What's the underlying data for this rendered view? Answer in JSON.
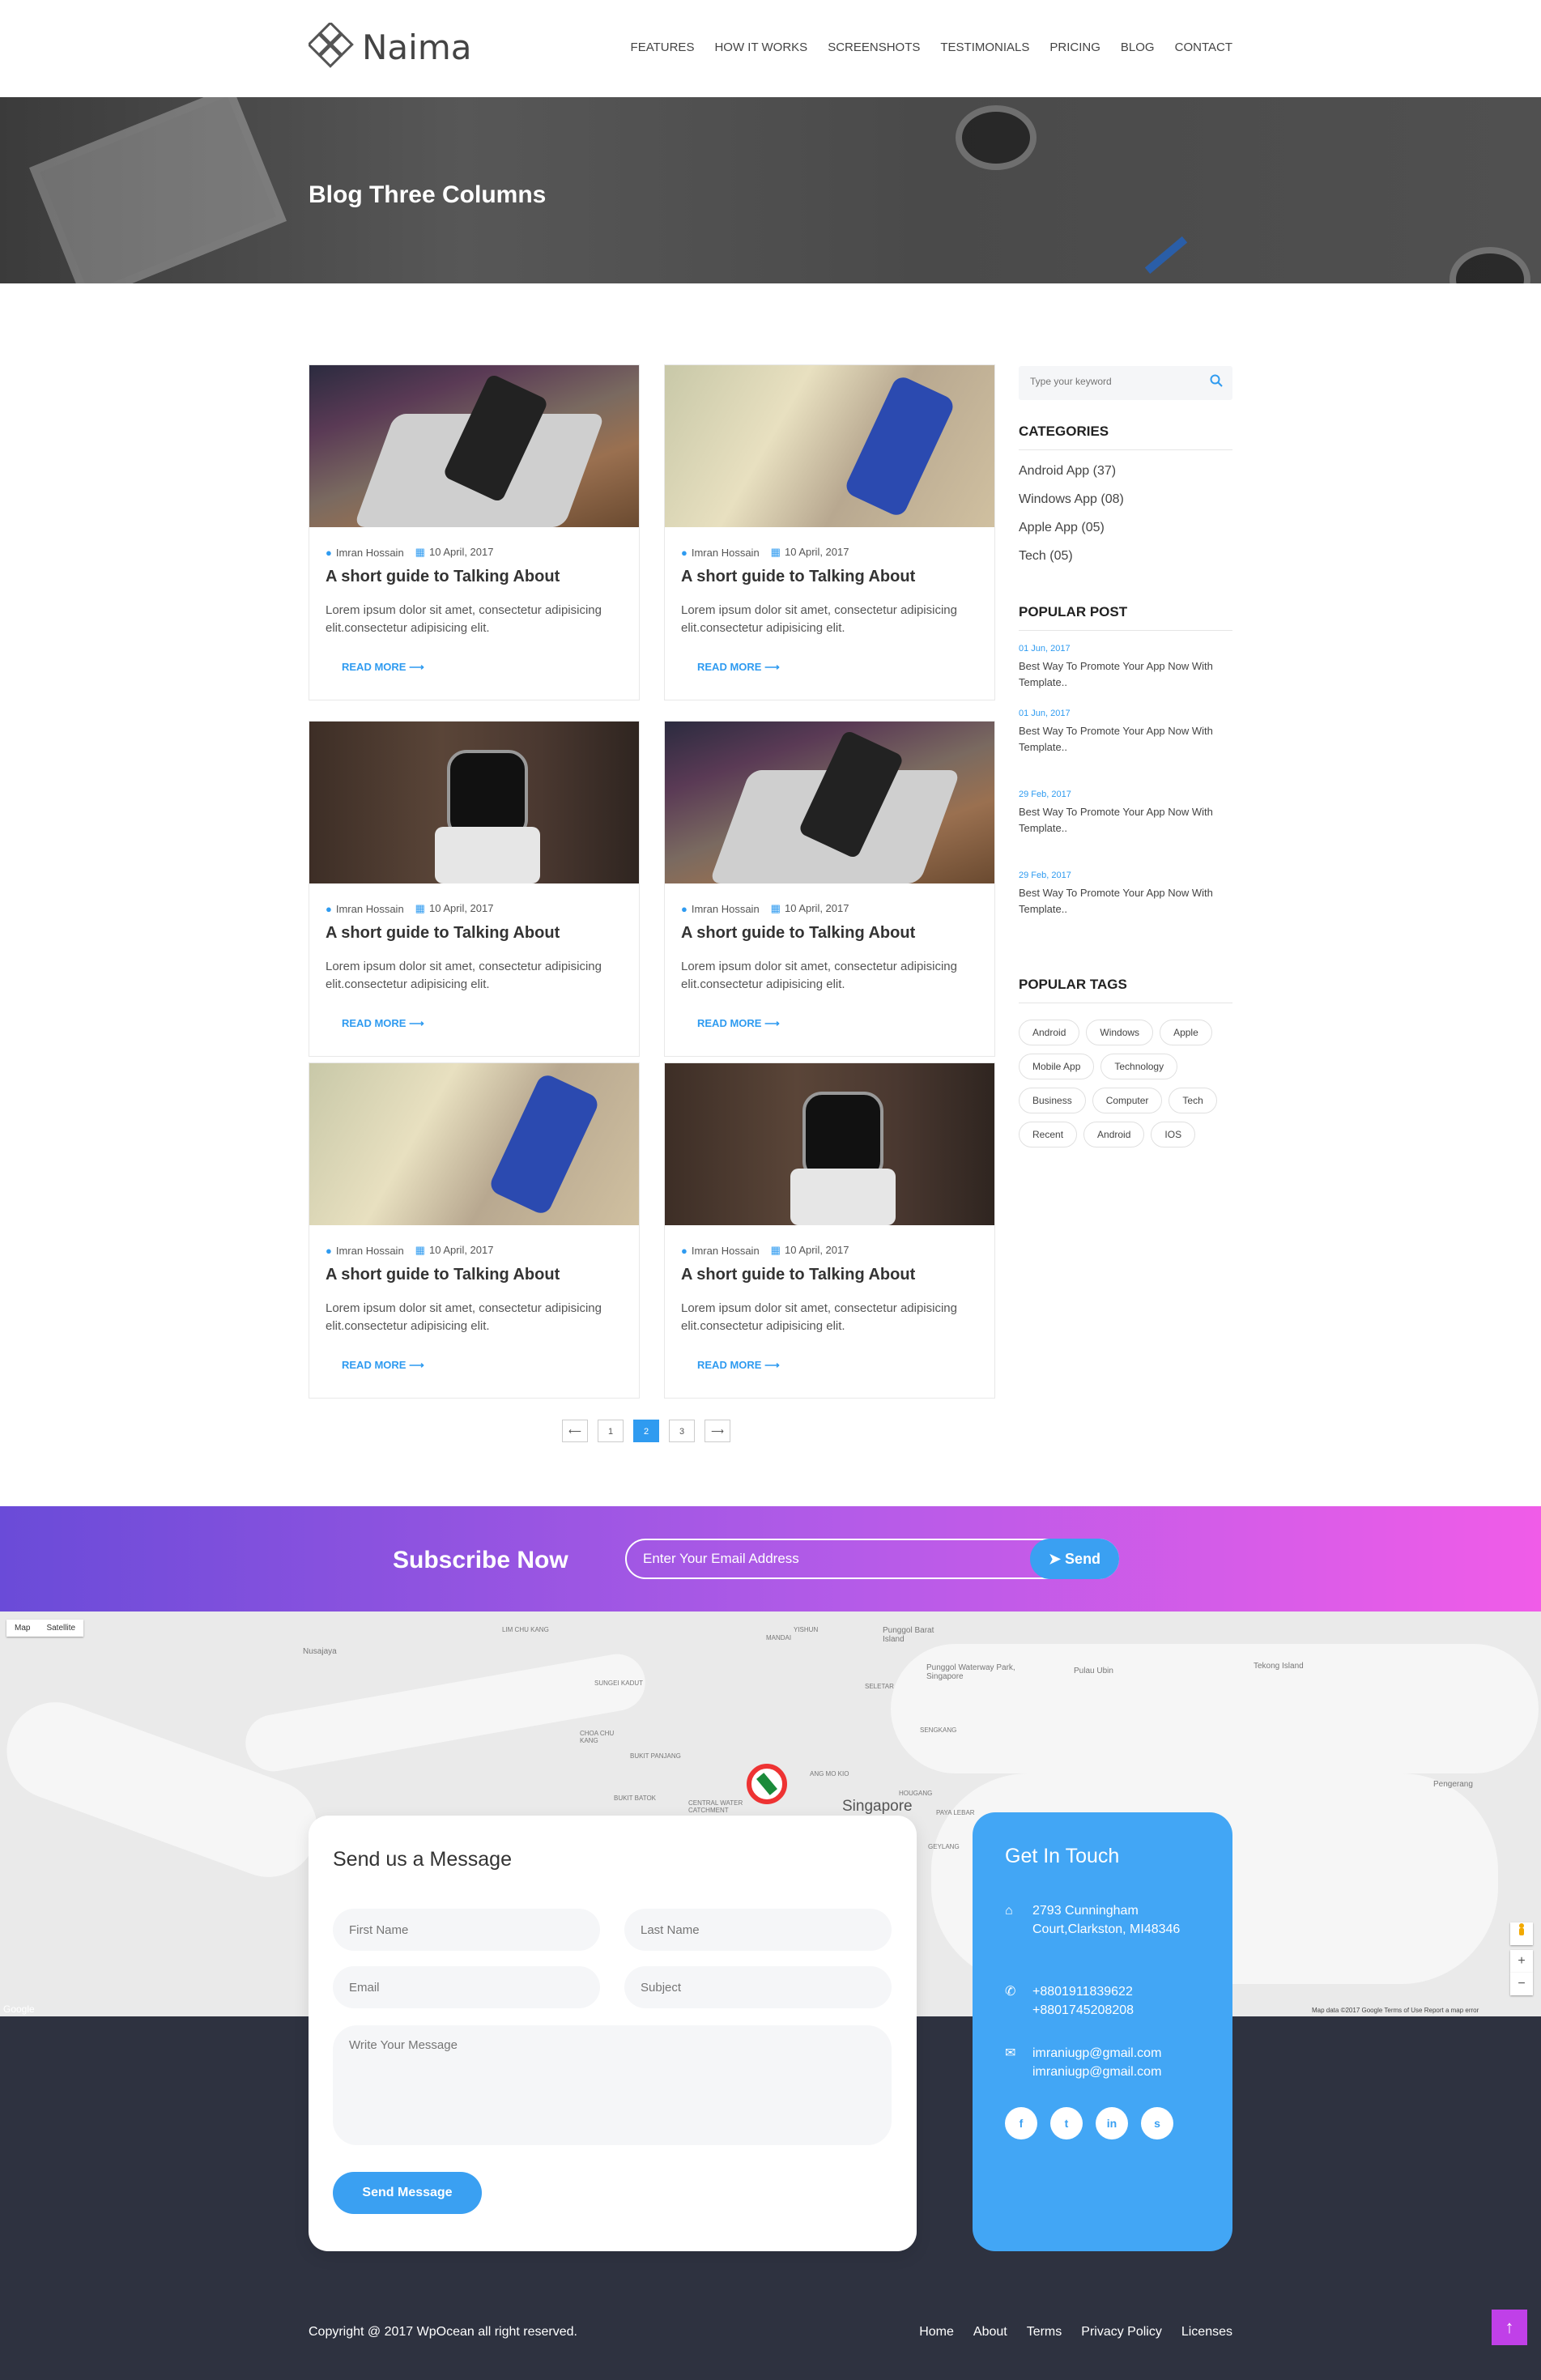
{
  "brand": {
    "name": "Naima"
  },
  "nav": [
    "FEATURES",
    "HOW IT WORKS",
    "SCREENSHOTS",
    "TESTIMONIALS",
    "PRICING",
    "BLOG",
    "CONTACT"
  ],
  "hero": {
    "title": "Blog Three Columns"
  },
  "posts": [
    {
      "image": "laptop",
      "author": "Imran Hossain",
      "date": "10 April, 2017",
      "title": "A short guide to Talking About",
      "excerpt": "Lorem ipsum dolor sit amet, consectetur adipisicing elit.consectetur adipisicing elit.",
      "more": "READ MORE"
    },
    {
      "image": "phone",
      "author": "Imran Hossain",
      "date": "10 April, 2017",
      "title": "A short guide to Talking About",
      "excerpt": "Lorem ipsum dolor sit amet, consectetur adipisicing elit.consectetur adipisicing elit.",
      "more": "READ MORE"
    },
    {
      "image": "watch",
      "author": "Imran Hossain",
      "date": "10 April, 2017",
      "title": "A short guide to Talking About",
      "excerpt": "Lorem ipsum dolor sit amet, consectetur adipisicing elit.consectetur adipisicing elit.",
      "more": "READ MORE"
    },
    {
      "image": "laptop",
      "author": "Imran Hossain",
      "date": "10 April, 2017",
      "title": "A short guide to Talking About",
      "excerpt": "Lorem ipsum dolor sit amet, consectetur adipisicing elit.consectetur adipisicing elit.",
      "more": "READ MORE"
    },
    {
      "image": "phone",
      "author": "Imran Hossain",
      "date": "10 April, 2017",
      "title": "A short guide to Talking About",
      "excerpt": "Lorem ipsum dolor sit amet, consectetur adipisicing elit.consectetur adipisicing elit.",
      "more": "READ MORE"
    },
    {
      "image": "watch",
      "author": "Imran Hossain",
      "date": "10 April, 2017",
      "title": "A short guide to Talking About",
      "excerpt": "Lorem ipsum dolor sit amet, consectetur adipisicing elit.consectetur adipisicing elit.",
      "more": "READ MORE"
    }
  ],
  "pagination": {
    "prev": "⟵",
    "pages": [
      "1",
      "2",
      "3"
    ],
    "active": "2",
    "next": "⟶"
  },
  "sidebar": {
    "search_placeholder": "Type your keyword",
    "categories_title": "CATEGORIES",
    "categories": [
      "Android App (37)",
      "Windows App (08)",
      "Apple App (05)",
      "Tech (05)"
    ],
    "popular_title": "POPULAR POST",
    "popular": [
      {
        "date": "01 Jun, 2017",
        "title": "Best Way To Promote Your App Now With Template.."
      },
      {
        "date": "01 Jun, 2017",
        "title": "Best Way To Promote Your App Now With Template.."
      },
      {
        "date": "29 Feb, 2017",
        "title": "Best Way To Promote Your App Now With Template.."
      },
      {
        "date": "29 Feb, 2017",
        "title": "Best Way To Promote Your App Now With Template.."
      }
    ],
    "tags_title": "POPULAR TAGS",
    "tags": [
      "Android",
      "Windows",
      "Apple",
      "Mobile App",
      "Technology",
      "Business",
      "Computer",
      "Tech",
      "Recent",
      "Android",
      "IOS"
    ]
  },
  "subscribe": {
    "title": "Subscribe Now",
    "placeholder": "Enter Your Email Address",
    "button": "Send"
  },
  "map": {
    "toggle": [
      "Map",
      "Satellite"
    ],
    "city": "Singapore",
    "labels": [
      "Nusajaya",
      "Punggol Barat Island",
      "Punggol Waterway Park, Singapore",
      "Pulau Ubin",
      "Tekong Island",
      "Pengerang",
      "SELETAR",
      "SENGKANG",
      "HOUGANG",
      "PAYA LEBAR",
      "BUKIT PANJANG",
      "CHOA CHU KANG",
      "BUKIT BATOK",
      "LIM CHU KANG",
      "MANDAI",
      "YISHUN",
      "SUNGEI KADUT",
      "GEYLANG",
      "CENTRAL WATER CATCHMENT",
      "ANG MO KIO"
    ],
    "footer": "Map data ©2017 Google   Terms of Use   Report a map error",
    "google": "Google",
    "zoom_in": "+",
    "zoom_out": "−"
  },
  "contact": {
    "title": "Send us a Message",
    "first_name": "First Name",
    "last_name": "Last Name",
    "email": "Email",
    "subject": "Subject",
    "message": "Write Your Message",
    "button": "Send Message"
  },
  "touch": {
    "title": "Get In Touch",
    "address": "2793 Cunningham Court,Clarkston, MI48346",
    "phone1": "+8801911839622",
    "phone2": "+8801745208208",
    "email1": "imraniugp@gmail.com",
    "email2": "imraniugp@gmail.com",
    "socials": [
      "f",
      "t",
      "in",
      "s"
    ]
  },
  "footer": {
    "copyright": "Copyright @ 2017 WpOcean all right reserved.",
    "links": [
      "Home",
      "About",
      "Terms",
      "Privacy Policy",
      "Licenses"
    ]
  },
  "colors": {
    "accent": "#2f9bf0",
    "footer": "#2e3240",
    "gradient_start": "#6a4bd8",
    "gradient_end": "#f05ce8"
  }
}
